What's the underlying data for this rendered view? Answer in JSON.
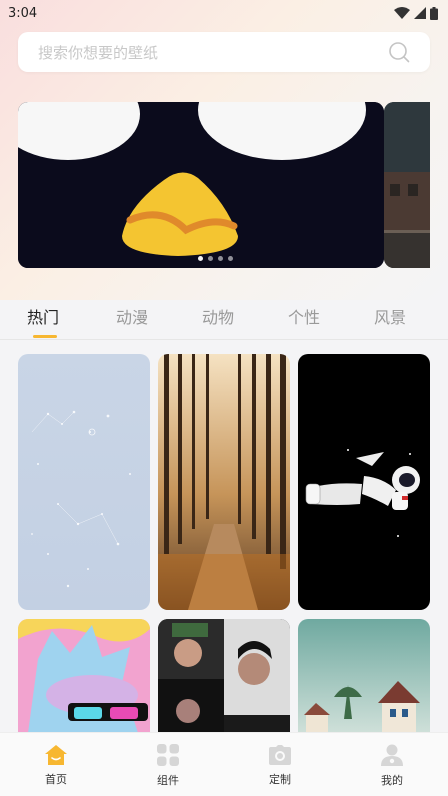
{
  "status_bar": {
    "time": "3:04"
  },
  "search": {
    "placeholder": "搜索你想要的壁纸"
  },
  "banner": {
    "page_count": 4,
    "active_page": 0
  },
  "tabs": [
    {
      "label": "热门",
      "active": true
    },
    {
      "label": "动漫",
      "active": false
    },
    {
      "label": "动物",
      "active": false
    },
    {
      "label": "个性",
      "active": false
    },
    {
      "label": "风景",
      "active": false
    }
  ],
  "wallpapers": [
    {
      "subject": "constellation"
    },
    {
      "subject": "forest-path"
    },
    {
      "subject": "astronaut"
    },
    {
      "subject": "cartoon-character"
    },
    {
      "subject": "portrait-collage"
    },
    {
      "subject": "lakeside-houses"
    }
  ],
  "bottom_nav": [
    {
      "label": "首页",
      "icon": "home-icon",
      "active": true
    },
    {
      "label": "组件",
      "icon": "widgets-icon",
      "active": false
    },
    {
      "label": "定制",
      "icon": "camera-icon",
      "active": false
    },
    {
      "label": "我的",
      "icon": "profile-icon",
      "active": false
    }
  ],
  "colors": {
    "accent": "#f7b731",
    "inactive_icon": "#d6d6d6"
  }
}
